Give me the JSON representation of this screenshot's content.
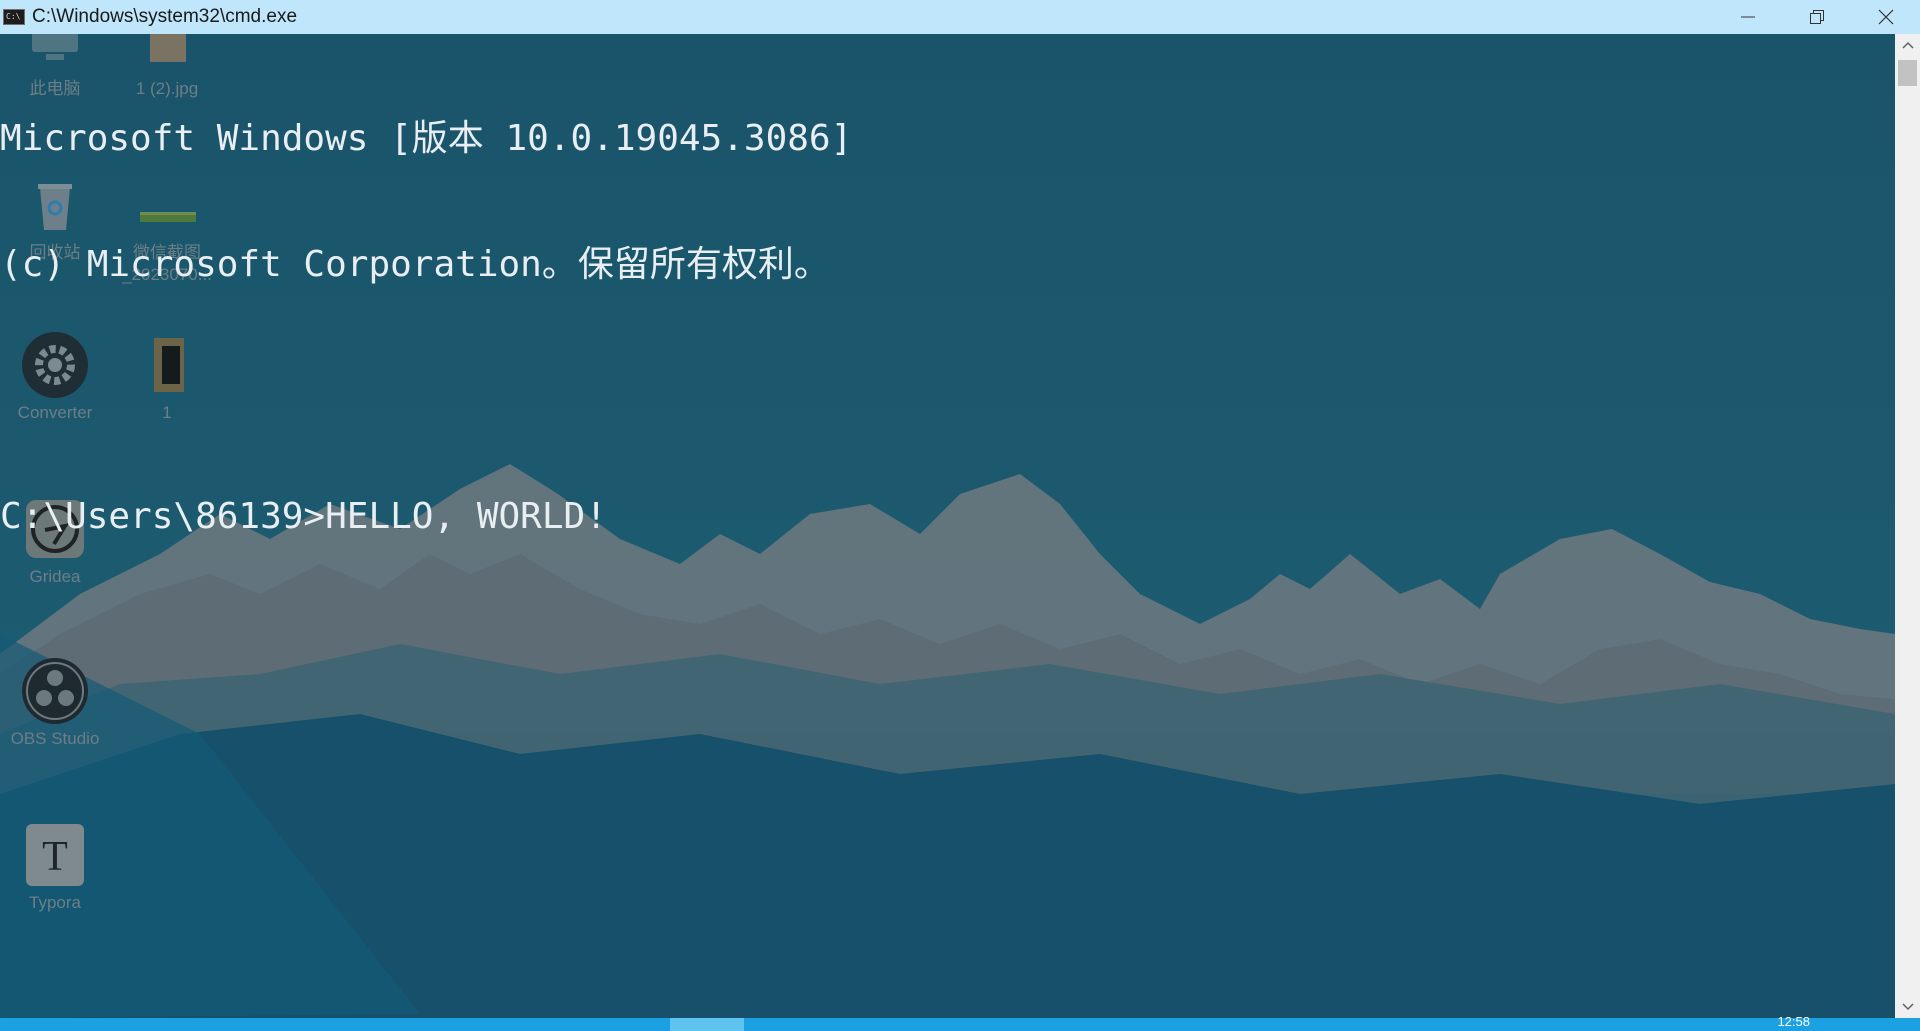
{
  "window": {
    "title": "C:\\Windows\\system32\\cmd.exe",
    "icon": "cmd-icon",
    "controls": [
      "minimize-icon",
      "restore-icon",
      "close-icon"
    ]
  },
  "terminal": {
    "lines": [
      "Microsoft Windows [版本 10.0.19045.3086]",
      "(c) Microsoft Corporation。保留所有权利。",
      "",
      "C:\\Users\\86139>HELLO, WORLD!"
    ]
  },
  "desktop_icons": [
    {
      "label": "此电脑",
      "icon": "computer-icon"
    },
    {
      "label": "1 (2).jpg",
      "icon": "image-icon"
    },
    {
      "label": "回收站",
      "icon": "recycle-bin-icon"
    },
    {
      "label": "微信截图\n_2023070...",
      "icon": "screenshot-icon"
    },
    {
      "label": "Converter",
      "icon": "gear-icon"
    },
    {
      "label": "1",
      "icon": "book-icon"
    },
    {
      "label": "Gridea",
      "icon": "gridea-icon"
    },
    {
      "label": "OBS Studio",
      "icon": "obs-icon"
    },
    {
      "label": "Typora",
      "icon": "typora-icon"
    }
  ],
  "taskbar": {
    "clock": "12:58"
  },
  "colors": {
    "titlebar": "#bfe6fb",
    "console_bg": "#1b5a70",
    "text": "#e8eef1",
    "taskbar": "#1ba1e2"
  }
}
